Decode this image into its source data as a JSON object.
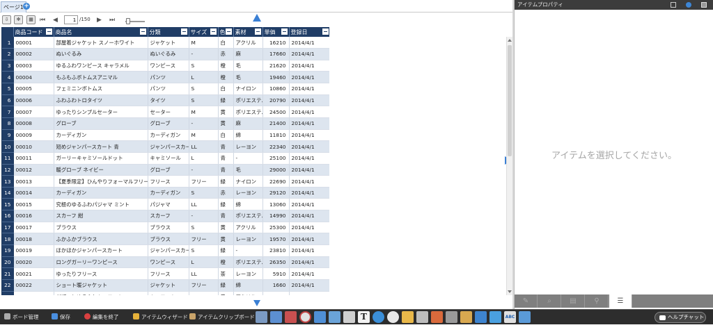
{
  "tabs": {
    "page_label": "ページ1",
    "add_label": "+"
  },
  "toolbar": {
    "current_page": "1",
    "total_pages": "/150",
    "first": "⏮",
    "prev": "◀",
    "next": "▶",
    "last": "⏭"
  },
  "grid": {
    "columns": [
      "商品コード",
      "商品名",
      "分類",
      "サイズ",
      "色",
      "素材",
      "単価",
      "登録日"
    ],
    "rows": [
      [
        "1",
        "00001",
        "部屋着ジャケット スノーホワイト",
        "ジャケット",
        "M",
        "白",
        "アクリル",
        "16210",
        "2014/4/1"
      ],
      [
        "2",
        "00002",
        "ぬいぐるみ",
        "ぬいぐるみ",
        "-",
        "赤",
        "麻",
        "17660",
        "2014/4/1"
      ],
      [
        "3",
        "00003",
        "ゆるふわワンピース キャラメル",
        "ワンピース",
        "S",
        "橙",
        "毛",
        "21620",
        "2014/4/1"
      ],
      [
        "4",
        "00004",
        "もふもふボトムスアニマル",
        "パンツ",
        "L",
        "橙",
        "毛",
        "19460",
        "2014/4/1"
      ],
      [
        "5",
        "00005",
        "フェミニンボトムス",
        "パンツ",
        "S",
        "白",
        "ナイロン",
        "10860",
        "2014/4/1"
      ],
      [
        "6",
        "00006",
        "ふわふわトロタイツ",
        "タイツ",
        "S",
        "緑",
        "ポリエステル",
        "20790",
        "2014/4/1"
      ],
      [
        "7",
        "00007",
        "ゆったりシンプルセーター",
        "セーター",
        "M",
        "黄",
        "ポリエステル",
        "24500",
        "2014/4/1"
      ],
      [
        "8",
        "00008",
        "グローブ",
        "グローブ",
        "-",
        "黄",
        "麻",
        "21400",
        "2014/4/1"
      ],
      [
        "9",
        "00009",
        "カーディガン",
        "カーディガン",
        "M",
        "白",
        "綿",
        "11810",
        "2014/4/1"
      ],
      [
        "10",
        "00010",
        "短めジャンパースカート 青",
        "ジャンパースカート",
        "LL",
        "青",
        "レーヨン",
        "22340",
        "2014/4/1"
      ],
      [
        "11",
        "00011",
        "ガーリーキャミソールドット",
        "キャミソール",
        "L",
        "青",
        "-",
        "25100",
        "2014/4/1"
      ],
      [
        "12",
        "00012",
        "暖グローブ ネイビー",
        "グローブ",
        "-",
        "青",
        "毛",
        "29000",
        "2014/4/1"
      ],
      [
        "13",
        "00013",
        "【夏季限定】ひんやりフォーマルフリース",
        "フリース",
        "フリー",
        "緑",
        "ナイロン",
        "22690",
        "2014/4/1"
      ],
      [
        "14",
        "00014",
        "カーディガン",
        "カーディガン",
        "S",
        "赤",
        "レーヨン",
        "29120",
        "2014/4/1"
      ],
      [
        "15",
        "00015",
        "究極のゆるふわパジャマ ミント",
        "パジャマ",
        "LL",
        "緑",
        "綿",
        "13060",
        "2014/4/1"
      ],
      [
        "16",
        "00016",
        "スカーフ 紺",
        "スカーフ",
        "-",
        "青",
        "ポリエステル",
        "14990",
        "2014/4/1"
      ],
      [
        "17",
        "00017",
        "ブラウス",
        "ブラウス",
        "S",
        "黄",
        "アクリル",
        "25300",
        "2014/4/1"
      ],
      [
        "18",
        "00018",
        "ふかふかブラウス",
        "ブラウス",
        "フリー",
        "黄",
        "レーヨン",
        "19570",
        "2014/4/1"
      ],
      [
        "19",
        "00019",
        "ほかほかジャンパースカート",
        "ジャンパースカート",
        "S",
        "緑",
        "-",
        "23810",
        "2014/4/1"
      ],
      [
        "20",
        "00020",
        "ロングガーリーワンピース",
        "ワンピース",
        "L",
        "橙",
        "ポリエステル",
        "26350",
        "2014/4/1"
      ],
      [
        "21",
        "00021",
        "ゆったりフリース",
        "フリース",
        "LL",
        "茶",
        "レーヨン",
        "5910",
        "2014/4/1"
      ],
      [
        "22",
        "00022",
        "ショート暖ジャケット",
        "ジャケット",
        "フリー",
        "緑",
        "綿",
        "1660",
        "2014/4/1"
      ],
      [
        "23",
        "00023",
        "だぼっとゆるふわキュロット",
        "キュロット",
        "S",
        "黄",
        "アクリル",
        "25180",
        "2014/4/1"
      ]
    ]
  },
  "panel": {
    "title": "アイテムプロパティ",
    "empty_message": "アイテムを選択してください。"
  },
  "bottom": {
    "board_mgmt": "ボード管理",
    "save": "保存",
    "end_edit": "編集を終了",
    "item_wizard": "アイテムウィザード",
    "item_clipboard": "アイテムクリップボード",
    "help_chat": "ヘルプチャット"
  },
  "colors": {
    "header_navy": "#203d66",
    "row_alt": "#dde5ef",
    "accent_blue": "#3a7fd4",
    "bottom_bar": "#2d2d2d"
  }
}
